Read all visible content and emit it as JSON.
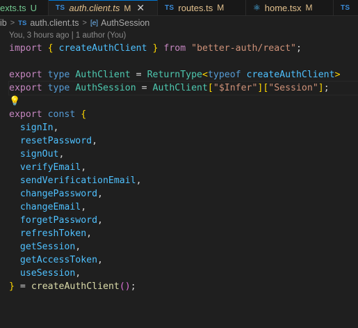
{
  "tabs": [
    {
      "name": "exts.ts",
      "status": "U"
    },
    {
      "icon": "TS",
      "name": "auth.client.ts",
      "status": "M",
      "close": "✕"
    },
    {
      "icon": "TS",
      "name": "routes.ts",
      "status": "M"
    },
    {
      "icon": "react-icon",
      "name": "home.tsx",
      "status": "M"
    },
    {
      "icon": "TS"
    }
  ],
  "breadcrumb": {
    "folder": "ib",
    "file": "auth.client.ts",
    "symbol": "AuthSession"
  },
  "blame": "You, 3 hours ago | 1 author (You)",
  "code": {
    "l1_import": "import",
    "l1_name": "createAuthClient",
    "l1_from": "from",
    "l1_module": "\"better-auth/react\"",
    "l3_export": "export",
    "l3_type": "type",
    "l3_name": "AuthClient",
    "l3_rt": "ReturnType",
    "l3_typeof": "typeof",
    "l3_fn": "createAuthClient",
    "l4_export": "export",
    "l4_type": "type",
    "l4_name": "AuthSession",
    "l4_ac": "AuthClient",
    "l4_infer": "\"$Infer\"",
    "l4_session": "\"Session\"",
    "l6_export": "export",
    "l6_const": "const",
    "members": [
      "signIn",
      "resetPassword",
      "signOut",
      "verifyEmail",
      "sendVerificationEmail",
      "changePassword",
      "changeEmail",
      "forgetPassword",
      "refreshToken",
      "getSession",
      "getAccessToken",
      "useSession"
    ],
    "last_fn": "createAuthClient"
  },
  "colors": {
    "background": "#1f1f1f",
    "keyword": "#569cd6",
    "control_keyword": "#c586c0",
    "function": "#dcdcaa",
    "type": "#4ec9b0",
    "string": "#ce9178",
    "variable": "#4fc1ff",
    "modified": "#e2c08d",
    "untracked": "#73c991"
  }
}
